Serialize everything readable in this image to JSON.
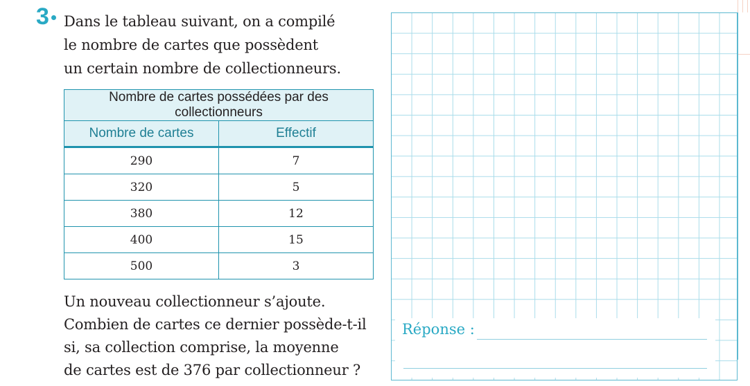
{
  "question": {
    "number": "3",
    "intro_lines": [
      "Dans le tableau suivant, on a compilé",
      "le nombre de cartes que possèdent",
      "un certain nombre de collectionneurs."
    ],
    "followup_lines": [
      "Un nouveau collectionneur s’ajoute.",
      "Combien de cartes ce dernier possède-t-il",
      "si, sa collection comprise, la moyenne",
      "de cartes est de 376 par collectionneur ?"
    ]
  },
  "table": {
    "title": "Nombre de cartes possédées par des collectionneurs",
    "headers": [
      "Nombre de cartes",
      "Effectif"
    ],
    "rows": [
      [
        "290",
        "7"
      ],
      [
        "320",
        "5"
      ],
      [
        "380",
        "12"
      ],
      [
        "400",
        "15"
      ],
      [
        "500",
        "3"
      ]
    ]
  },
  "answer": {
    "label": "Réponse :"
  },
  "colors": {
    "accent": "#29a9c4",
    "table_border": "#1f93ad",
    "table_header_bg": "#e0f2f6",
    "grid_line": "#a9dcea"
  }
}
